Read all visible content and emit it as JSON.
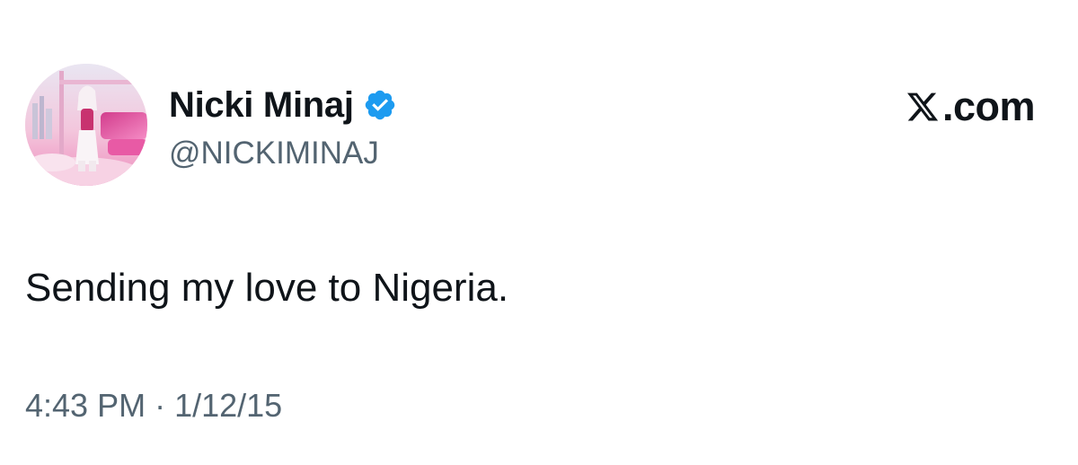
{
  "author": {
    "display_name": "Nicki Minaj",
    "handle": "@NICKIMINAJ",
    "verified_icon": "verified-badge-icon"
  },
  "brand": {
    "icon": "x-logo-icon",
    "text": ".com"
  },
  "tweet": {
    "text": "Sending my love to Nigeria.",
    "time": "4:43 PM",
    "separator": "·",
    "date": "1/12/15"
  },
  "colors": {
    "text": "#0f1419",
    "secondary": "#536471",
    "verified": "#1d9bf0",
    "avatar_pink": "#f06ab0"
  }
}
